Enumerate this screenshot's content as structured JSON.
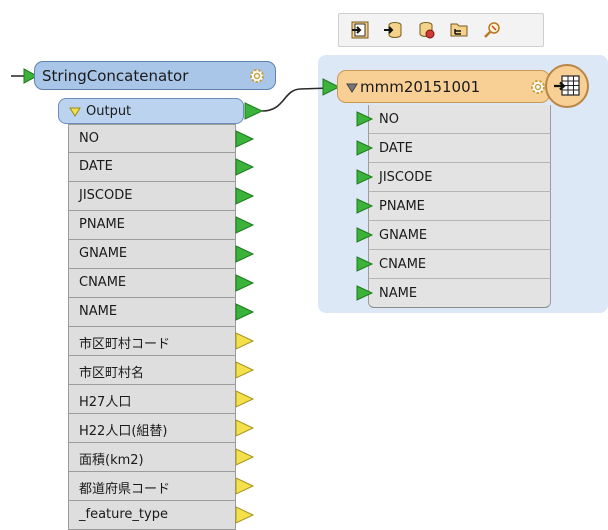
{
  "transformer": {
    "name": "StringConcatenator",
    "output_port": "Output",
    "attributes": [
      {
        "label": "NO",
        "port": "connected"
      },
      {
        "label": "DATE",
        "port": "connected"
      },
      {
        "label": "JISCODE",
        "port": "connected"
      },
      {
        "label": "PNAME",
        "port": "connected"
      },
      {
        "label": "GNAME",
        "port": "connected"
      },
      {
        "label": "CNAME",
        "port": "connected"
      },
      {
        "label": "NAME",
        "port": "connected"
      },
      {
        "label": "市区町村コード",
        "port": "unexposed"
      },
      {
        "label": "市区町村名",
        "port": "unexposed"
      },
      {
        "label": "H27人口",
        "port": "unexposed"
      },
      {
        "label": "H22人口(組替)",
        "port": "unexposed"
      },
      {
        "label": "面積(km2)",
        "port": "unexposed"
      },
      {
        "label": "都道府県コード",
        "port": "unexposed"
      },
      {
        "label": "_feature_type",
        "port": "unexposed"
      }
    ]
  },
  "writer": {
    "name": "mmm20151001",
    "attributes": [
      "NO",
      "DATE",
      "JISCODE",
      "PNAME",
      "GNAME",
      "CNAME",
      "NAME"
    ]
  },
  "toolbar": {
    "buttons": [
      "open-writer-icon",
      "database-import-icon",
      "database-settings-icon",
      "folder-tree-icon",
      "inspect-icon"
    ]
  },
  "colors": {
    "connected_port": "#3bb33b",
    "unexposed_port": "#f3e04a",
    "transformer": "#a9c6e8",
    "writer": "#f8cf95",
    "writer_panel": "#dde8f6"
  }
}
